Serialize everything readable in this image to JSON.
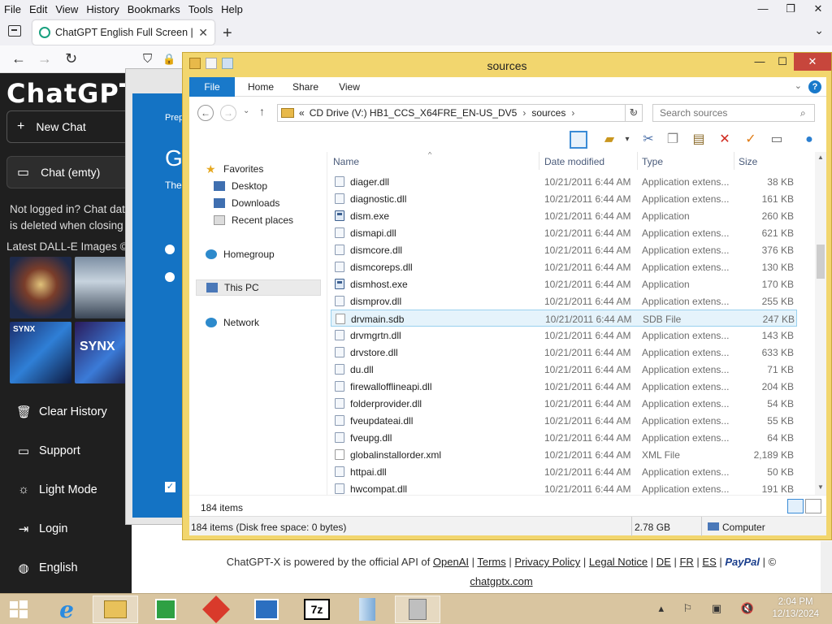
{
  "firefox": {
    "menu": [
      "File",
      "Edit",
      "View",
      "History",
      "Bookmarks",
      "Tools",
      "Help"
    ],
    "window_controls": [
      "—",
      "❐",
      "✕"
    ],
    "tab_title": "ChatGPT English Full Screen | X",
    "new_tab": "+",
    "tab_list": "⌄",
    "nav": {
      "back": "←",
      "forward": "→",
      "reload": "↻",
      "shield": "⛉",
      "lock": "🔒"
    }
  },
  "sidebar": {
    "logo": "ChatGPT-X",
    "new_chat_label": "New Chat",
    "chat_item_label": "Chat (emty)",
    "notice": "Not logged in? Chat data is deleted when closing or",
    "dalle_heading": "Latest DALL-E Images ©",
    "thumb_labels": [
      "SYNX",
      "SYNX"
    ],
    "links": [
      {
        "label": "Clear History",
        "icon": "trash-icon"
      },
      {
        "label": "Support",
        "icon": "support-icon"
      },
      {
        "label": "Light Mode",
        "icon": "sun-icon"
      },
      {
        "label": "Login",
        "icon": "login-icon"
      },
      {
        "label": "English",
        "icon": "globe-icon"
      }
    ]
  },
  "setup_window": {
    "prep_text": "Prep",
    "big_letter": "G",
    "these_text": "The"
  },
  "footer": {
    "prefix": "ChatGPT-X is powered by the official API of ",
    "links": [
      "OpenAI",
      "Terms",
      "Privacy Policy",
      "Legal Notice",
      "DE",
      "FR",
      "ES"
    ],
    "paypal": "PayPal",
    "copyright": "©",
    "domain": "chatgptx.com"
  },
  "explorer": {
    "title": "sources",
    "window_controls": {
      "min": "—",
      "max": "☐",
      "close": "✕"
    },
    "ribbon_tabs": [
      "File",
      "Home",
      "Share",
      "View"
    ],
    "help": "?",
    "breadcrumb": [
      "CD Drive (V:) HB1_CCS_X64FRE_EN-US_DV5",
      "sources"
    ],
    "breadcrumb_prefix": "«",
    "search_placeholder": "Search sources",
    "nav_pane": {
      "favorites": "Favorites",
      "favorites_items": [
        "Desktop",
        "Downloads",
        "Recent places"
      ],
      "homegroup": "Homegroup",
      "this_pc": "This PC",
      "network": "Network"
    },
    "columns": {
      "name": "Name",
      "date": "Date modified",
      "type": "Type",
      "size": "Size"
    },
    "files": [
      {
        "name": "diager.dll",
        "date": "10/21/2011 6:44 AM",
        "type": "Application extens...",
        "size": "38 KB",
        "kind": "dll"
      },
      {
        "name": "diagnostic.dll",
        "date": "10/21/2011 6:44 AM",
        "type": "Application extens...",
        "size": "161 KB",
        "kind": "dll"
      },
      {
        "name": "dism.exe",
        "date": "10/21/2011 6:44 AM",
        "type": "Application",
        "size": "260 KB",
        "kind": "exe"
      },
      {
        "name": "dismapi.dll",
        "date": "10/21/2011 6:44 AM",
        "type": "Application extens...",
        "size": "621 KB",
        "kind": "dll"
      },
      {
        "name": "dismcore.dll",
        "date": "10/21/2011 6:44 AM",
        "type": "Application extens...",
        "size": "376 KB",
        "kind": "dll"
      },
      {
        "name": "dismcoreps.dll",
        "date": "10/21/2011 6:44 AM",
        "type": "Application extens...",
        "size": "130 KB",
        "kind": "dll"
      },
      {
        "name": "dismhost.exe",
        "date": "10/21/2011 6:44 AM",
        "type": "Application",
        "size": "170 KB",
        "kind": "exe"
      },
      {
        "name": "dismprov.dll",
        "date": "10/21/2011 6:44 AM",
        "type": "Application extens...",
        "size": "255 KB",
        "kind": "dll"
      },
      {
        "name": "drvmain.sdb",
        "date": "10/21/2011 6:44 AM",
        "type": "SDB File",
        "size": "247 KB",
        "kind": "file",
        "selected": true
      },
      {
        "name": "drvmgrtn.dll",
        "date": "10/21/2011 6:44 AM",
        "type": "Application extens...",
        "size": "143 KB",
        "kind": "dll"
      },
      {
        "name": "drvstore.dll",
        "date": "10/21/2011 6:44 AM",
        "type": "Application extens...",
        "size": "633 KB",
        "kind": "dll"
      },
      {
        "name": "du.dll",
        "date": "10/21/2011 6:44 AM",
        "type": "Application extens...",
        "size": "71 KB",
        "kind": "dll"
      },
      {
        "name": "firewallofflineapi.dll",
        "date": "10/21/2011 6:44 AM",
        "type": "Application extens...",
        "size": "204 KB",
        "kind": "dll"
      },
      {
        "name": "folderprovider.dll",
        "date": "10/21/2011 6:44 AM",
        "type": "Application extens...",
        "size": "54 KB",
        "kind": "dll"
      },
      {
        "name": "fveupdateai.dll",
        "date": "10/21/2011 6:44 AM",
        "type": "Application extens...",
        "size": "55 KB",
        "kind": "dll"
      },
      {
        "name": "fveupg.dll",
        "date": "10/21/2011 6:44 AM",
        "type": "Application extens...",
        "size": "64 KB",
        "kind": "dll"
      },
      {
        "name": "globalinstallorder.xml",
        "date": "10/21/2011 6:44 AM",
        "type": "XML File",
        "size": "2,189 KB",
        "kind": "file"
      },
      {
        "name": "httpai.dll",
        "date": "10/21/2011 6:44 AM",
        "type": "Application extens...",
        "size": "50 KB",
        "kind": "dll"
      },
      {
        "name": "hwcompat.dll",
        "date": "10/21/2011 6:44 AM",
        "type": "Application extens...",
        "size": "191 KB",
        "kind": "dll"
      }
    ],
    "item_count": "184 items",
    "details_bar": {
      "left": "184 items (Disk free space: 0 bytes)",
      "mid": "2.78 GB",
      "right": "Computer"
    }
  },
  "taskbar": {
    "time": "2:04 PM",
    "date": "12/13/2024",
    "icons": [
      "windows-start-icon",
      "internet-explorer-icon",
      "file-explorer-icon",
      "store-icon",
      "anydesk-icon",
      "app-icon",
      "7zip-icon",
      "setup-icon",
      "usb-drive-icon"
    ],
    "sevenzip_label": "7z",
    "tray": "▴ ⚐ ▣ 🔇"
  },
  "colors": {
    "explorer_frame": "#f2d66e",
    "file_tab": "#1979ca",
    "sidebar_bg": "#1f1f1f",
    "taskbar": "#d9c5a0",
    "close_btn": "#c7463c"
  }
}
